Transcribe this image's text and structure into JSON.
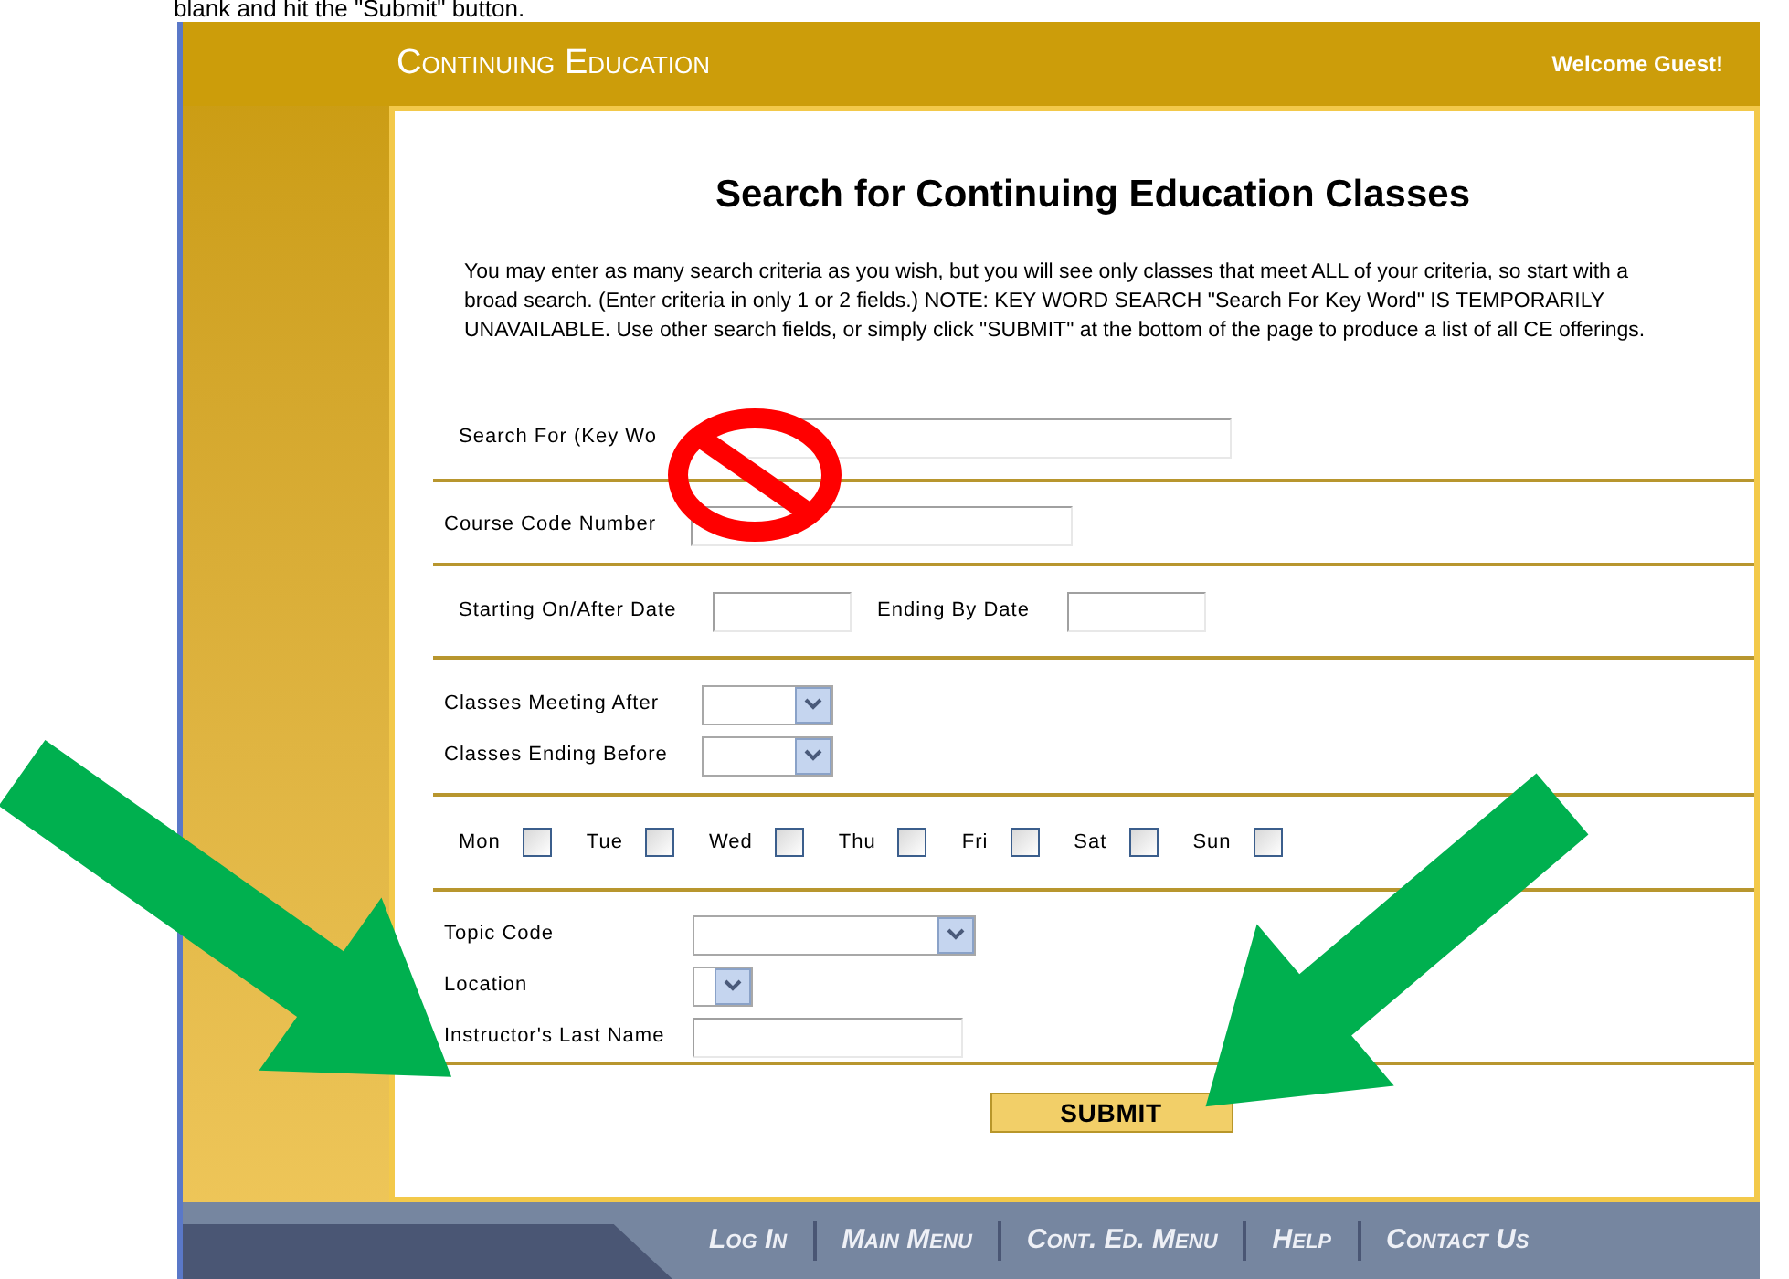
{
  "caption": "blank and hit the \"Submit\" button.",
  "header": {
    "title": "Continuing Education",
    "welcome": "Welcome Guest!"
  },
  "page_title": "Search for Continuing Education Classes",
  "intro": "You may enter as many search criteria as you wish, but you will see only classes that meet ALL of your criteria, so start with a broad search. (Enter criteria in only 1 or 2 fields.) NOTE: KEY WORD SEARCH \"Search For Key Word\" IS TEMPORARILY UNAVAILABLE. Use other search fields, or simply click \"SUBMIT\" at the bottom of the page to produce a list of all CE offerings.",
  "sections": [
    {
      "rows": [
        [
          {
            "kind": "text",
            "label": "Search For (Key Wo"
          }
        ]
      ]
    },
    {
      "rows": [
        [
          {
            "kind": "text",
            "label": "Course Code Number"
          }
        ]
      ]
    },
    {
      "rows": [
        [
          {
            "kind": "text",
            "label": "Starting On/After Date"
          },
          {
            "kind": "text",
            "label": "Ending By Date"
          }
        ]
      ]
    },
    {
      "rows": [
        [
          {
            "kind": "select",
            "label": "Classes Meeting After"
          }
        ],
        [
          {
            "kind": "select",
            "label": "Classes Ending Before"
          }
        ]
      ]
    },
    {
      "rows": [
        [
          {
            "kind": "checkbox",
            "label": "Mon",
            "checked": false
          },
          {
            "kind": "checkbox",
            "label": "Tue",
            "checked": false
          },
          {
            "kind": "checkbox",
            "label": "Wed",
            "checked": false
          },
          {
            "kind": "checkbox",
            "label": "Thu",
            "checked": false
          },
          {
            "kind": "checkbox",
            "label": "Fri",
            "checked": false
          },
          {
            "kind": "checkbox",
            "label": "Sat",
            "checked": false
          },
          {
            "kind": "checkbox",
            "label": "Sun",
            "checked": false
          }
        ]
      ]
    },
    {
      "rows": [
        [
          {
            "kind": "select",
            "label": "Topic Code"
          }
        ],
        [
          {
            "kind": "select",
            "label": "Location"
          }
        ],
        [
          {
            "kind": "text",
            "label": "Instructor's Last Name"
          }
        ]
      ]
    }
  ],
  "submit": "SUBMIT",
  "footer_links": [
    "Log In",
    "Main Menu",
    "Cont. Ed. Menu",
    "Help",
    "Contact Us"
  ]
}
